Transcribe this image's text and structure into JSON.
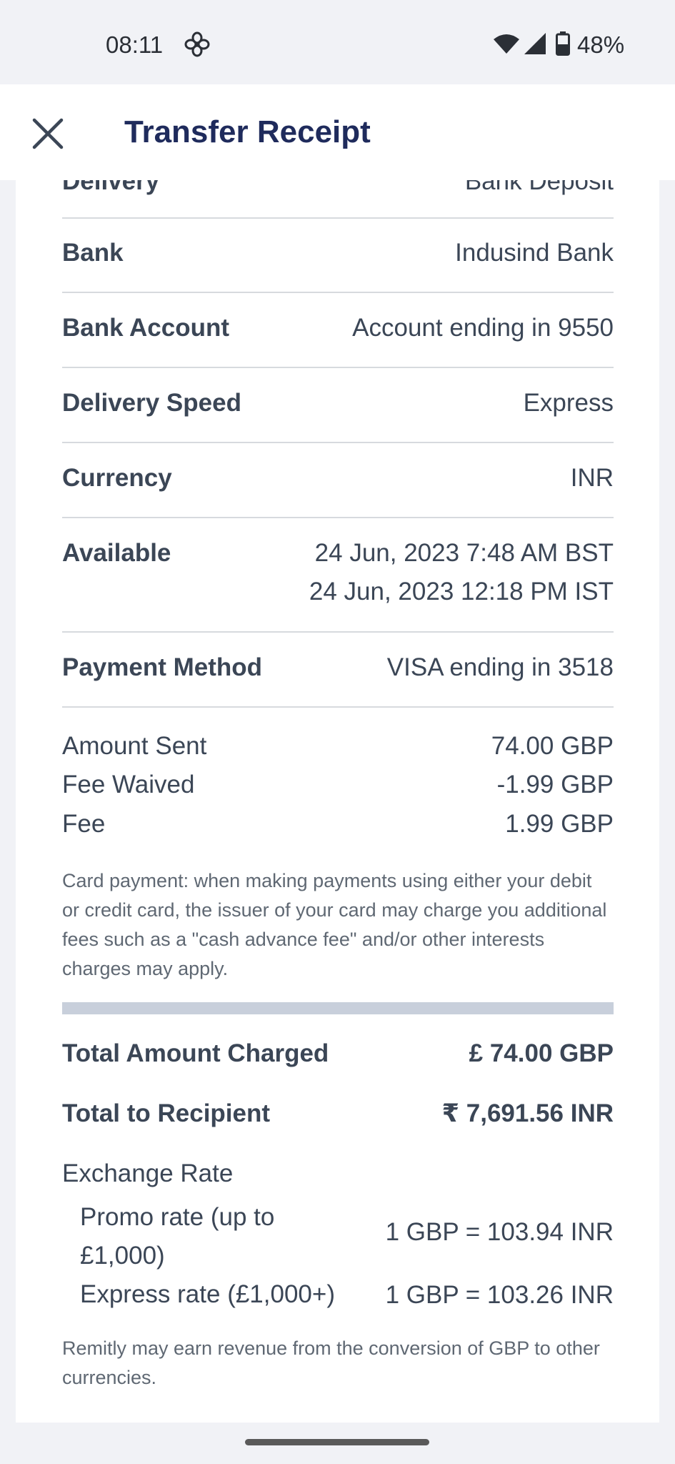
{
  "status_bar": {
    "time": "08:11",
    "battery": "48%",
    "icons": [
      "fan-icon",
      "wifi-icon",
      "signal-icon",
      "battery-icon"
    ]
  },
  "header": {
    "title": "Transfer Receipt",
    "close_icon": "close-icon"
  },
  "details": {
    "delivery_partial": {
      "label": "Delivery",
      "value": "Bank Deposit"
    },
    "bank": {
      "label": "Bank",
      "value": "Indusind Bank"
    },
    "bank_account": {
      "label": "Bank Account",
      "value": "Account ending in 9550"
    },
    "delivery_speed": {
      "label": "Delivery Speed",
      "value": "Express"
    },
    "currency": {
      "label": "Currency",
      "value": "INR"
    },
    "available": {
      "label": "Available",
      "value_line1": "24 Jun, 2023 7:48 AM BST",
      "value_line2": "24 Jun, 2023 12:18 PM IST"
    },
    "payment_method": {
      "label": "Payment Method",
      "value": "VISA ending in 3518"
    }
  },
  "amounts": {
    "amount_sent": {
      "label": "Amount Sent",
      "value": "74.00 GBP"
    },
    "fee_waived": {
      "label": "Fee Waived",
      "value": "-1.99 GBP"
    },
    "fee": {
      "label": "Fee",
      "value": "1.99 GBP"
    }
  },
  "card_note": "Card payment: when making payments using either your debit or credit card, the issuer of your card may charge you additional fees such as a \"cash advance fee\" and/or other interests charges may apply.",
  "totals": {
    "total_charged": {
      "label": "Total Amount Charged",
      "value": "£ 74.00 GBP"
    },
    "total_recipient": {
      "label": "Total to Recipient",
      "value": "₹ 7,691.56 INR"
    }
  },
  "exchange": {
    "title": "Exchange Rate",
    "promo": {
      "label_line1": "Promo rate (up to",
      "label_line2": "£1,000)",
      "value": "1 GBP = 103.94 INR"
    },
    "express": {
      "label": "Express rate (£1,000+)",
      "value": "1 GBP = 103.26 INR"
    }
  },
  "revenue_note": "Remitly may earn revenue from the conversion of GBP to other currencies.",
  "colors": {
    "background": "#f1f2f6",
    "title": "#1f2b5c",
    "text": "#3b4656",
    "divider": "#d7dade",
    "thick_bar": "#c8cfdb"
  }
}
